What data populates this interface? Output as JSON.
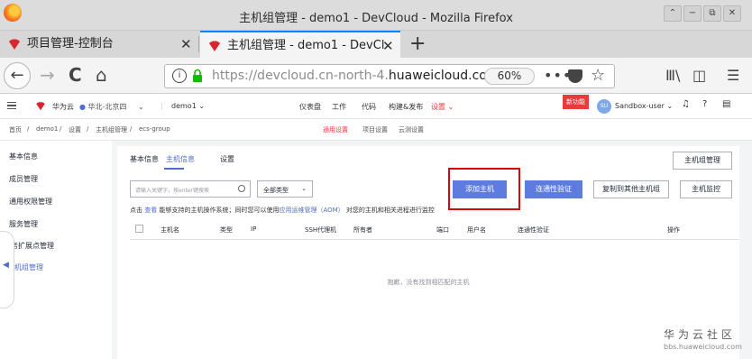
{
  "window": {
    "title": "主机组管理 - demo1 - DevCloud - Mozilla Firefox",
    "controls": [
      "⌃",
      "−",
      "⧉",
      "✕"
    ]
  },
  "tabs": [
    {
      "label": "项目管理-控制台",
      "close": "✕"
    },
    {
      "label": "主机组管理 - demo1 - DevCl",
      "close": "✕"
    }
  ],
  "newtab": "+",
  "nav": {
    "back": "←",
    "forward": "→",
    "reload": "C",
    "home": "⌂",
    "url_prefix": "https://devcloud.cn-north-4.",
    "url_domain": "huaweicloud.com",
    "zoom": "60%",
    "more": "•••",
    "star": "☆",
    "library": "Ⅲ\\",
    "sidebar_icon": "◫",
    "menu": "☰"
  },
  "header": {
    "brand": "华为云",
    "region": "华北-北京四",
    "project": "demo1",
    "links": [
      "仪表盘",
      "工作",
      "代码",
      "构建&发布",
      "设置"
    ],
    "new_feature": "新功能",
    "avatar": "SU",
    "user": "Sandbox-user"
  },
  "breadcrumb": {
    "items": [
      "首页",
      "/",
      "demo1",
      "/",
      "设置",
      "/",
      "主机组管理",
      "/",
      "ecs-group"
    ],
    "center_tabs": [
      "通用设置",
      "项目设置",
      "云测设置"
    ]
  },
  "sidebar": {
    "items": [
      "基本信息",
      "成员管理",
      "通用权限管理",
      "服务管理",
      "服务扩展点管理",
      "主机组管理"
    ]
  },
  "main": {
    "tabs": [
      "基本信息",
      "主机信息",
      "设置"
    ],
    "group_manage_btn": "主机组管理",
    "search_placeholder": "请输入关键字，按enter键搜索",
    "type_select": "全部类型",
    "buttons": [
      "添加主机",
      "连通性验证",
      "复制到其他主机组",
      "主机监控"
    ],
    "tip": {
      "prefix": "点击",
      "link1": "查看",
      "mid": "能够支持的主机操作系统；同时您可以使用",
      "link2": "应用运维管理（AOM）",
      "suffix": "对您的主机和相关进程进行监控"
    },
    "columns": [
      "主机名",
      "类型",
      "IP",
      "SSH代理机",
      "所有者",
      "端口",
      "用户名",
      "连通性验证",
      "操作"
    ],
    "empty_text": "抱歉，没有找到相匹配的主机"
  },
  "watermark": {
    "line1": "华为云社区",
    "line2": "bbs.huaweicloud.com"
  },
  "colors": {
    "primary": "#5e7ce0",
    "link": "#526ecc",
    "highlight_box": "#d10b0b",
    "tab_indicator": "#0a84ff"
  }
}
